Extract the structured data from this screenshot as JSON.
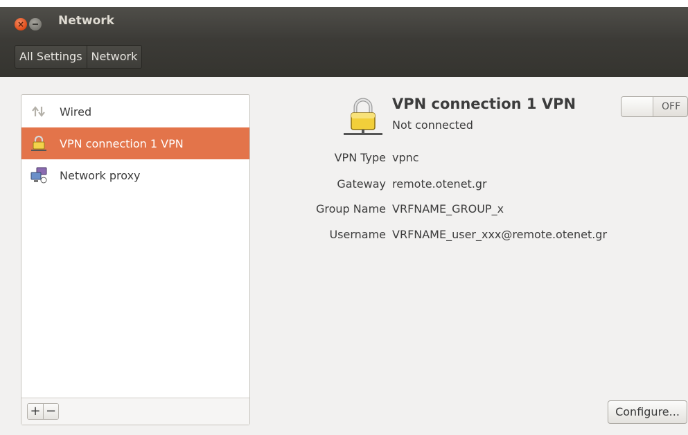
{
  "window": {
    "title": "Network",
    "close_glyph": "×"
  },
  "breadcrumbs": [
    {
      "label": "All Settings"
    },
    {
      "label": "Network"
    }
  ],
  "list": {
    "items": [
      {
        "label": "Wired",
        "icon": "network-wired-icon",
        "selected": false
      },
      {
        "label": "VPN connection 1 VPN",
        "icon": "vpn-lock-icon",
        "selected": true
      },
      {
        "label": "Network proxy",
        "icon": "network-proxy-icon",
        "selected": false
      }
    ],
    "add_label": "+",
    "remove_label": "−"
  },
  "detail": {
    "title": "VPN connection 1 VPN",
    "status": "Not connected",
    "toggle_state": "OFF",
    "properties": [
      {
        "label": "VPN Type",
        "value": "vpnc"
      },
      {
        "label": "Gateway",
        "value": "remote.otenet.gr"
      },
      {
        "label": "Group Name",
        "value": "VRFNAME_GROUP_x"
      },
      {
        "label": "Username",
        "value": "VRFNAME_user_xxx@remote.otenet.gr"
      }
    ],
    "configure_label": "Configure..."
  },
  "colors": {
    "selection": "#e3744a",
    "titlebar": "#3d3c38",
    "close": "#df4a16"
  }
}
